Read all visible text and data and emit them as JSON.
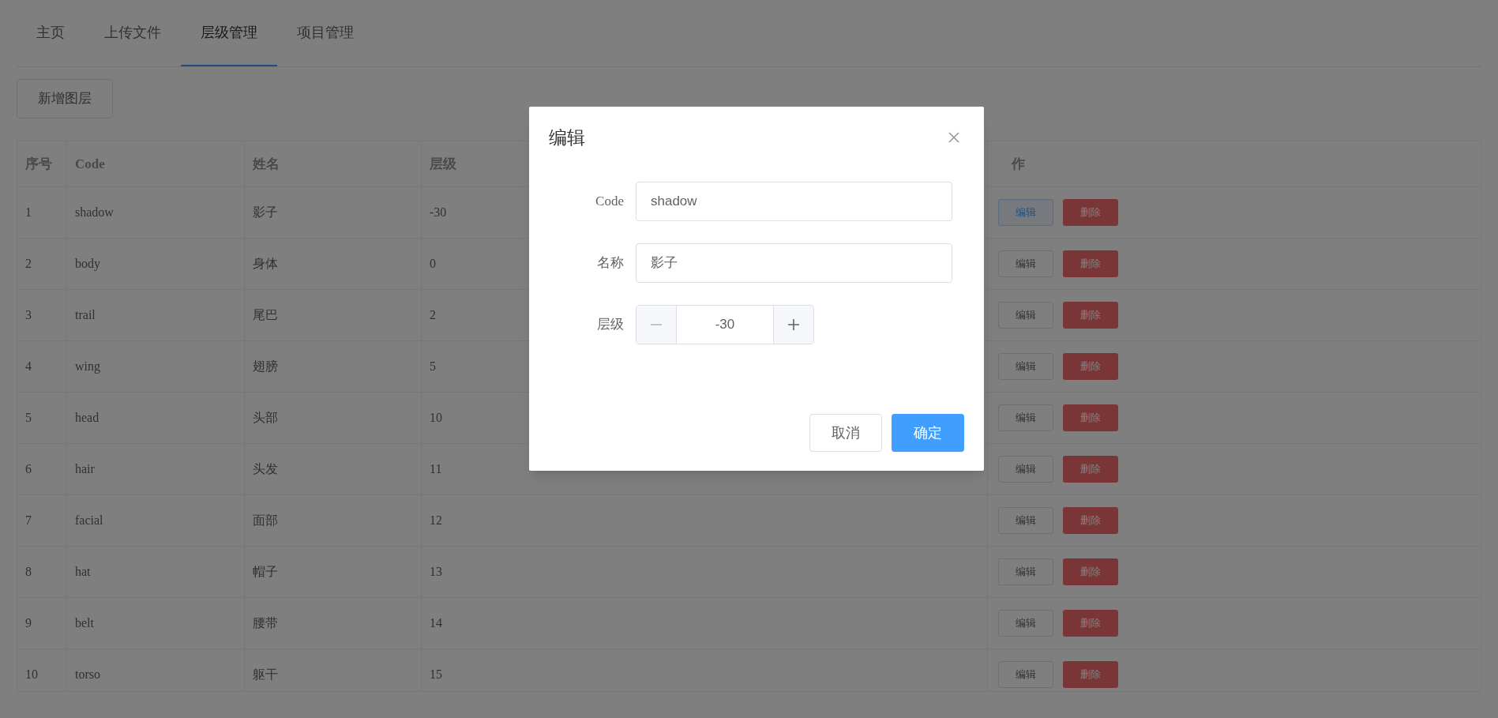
{
  "tabs": [
    {
      "label": "主页",
      "selected": false
    },
    {
      "label": "上传文件",
      "selected": false
    },
    {
      "label": "层级管理",
      "selected": true
    },
    {
      "label": "项目管理",
      "selected": false
    }
  ],
  "add_button": "新增图层",
  "table": {
    "columns": [
      "序号",
      "Code",
      "姓名",
      "层级",
      "作"
    ],
    "rows": [
      {
        "cells": [
          "1",
          "shadow",
          "影子",
          "-30"
        ],
        "edit": "编辑",
        "edit_focused": true,
        "delete": "删除"
      },
      {
        "cells": [
          "2",
          "body",
          "身体",
          "0"
        ],
        "edit": "编辑",
        "edit_focused": false,
        "delete": "删除"
      },
      {
        "cells": [
          "3",
          "trail",
          "尾巴",
          "2"
        ],
        "edit": "编辑",
        "edit_focused": false,
        "delete": "删除"
      },
      {
        "cells": [
          "4",
          "wing",
          "翅膀",
          "5"
        ],
        "edit": "编辑",
        "edit_focused": false,
        "delete": "删除"
      },
      {
        "cells": [
          "5",
          "head",
          "头部",
          "10"
        ],
        "edit": "编辑",
        "edit_focused": false,
        "delete": "删除"
      },
      {
        "cells": [
          "6",
          "hair",
          "头发",
          "11"
        ],
        "edit": "编辑",
        "edit_focused": false,
        "delete": "删除"
      },
      {
        "cells": [
          "7",
          "facial",
          "面部",
          "12"
        ],
        "edit": "编辑",
        "edit_focused": false,
        "delete": "删除"
      },
      {
        "cells": [
          "8",
          "hat",
          "帽子",
          "13"
        ],
        "edit": "编辑",
        "edit_focused": false,
        "delete": "删除"
      },
      {
        "cells": [
          "9",
          "belt",
          "腰带",
          "14"
        ],
        "edit": "编辑",
        "edit_focused": false,
        "delete": "删除"
      },
      {
        "cells": [
          "10",
          "torso",
          "躯干",
          "15"
        ],
        "edit": "编辑",
        "edit_focused": false,
        "delete": "删除"
      }
    ]
  },
  "dialog": {
    "title": "编辑",
    "fields": [
      {
        "kind": "text",
        "label": "Code",
        "value": "shadow"
      },
      {
        "kind": "text",
        "label": "名称",
        "value": "影子"
      },
      {
        "kind": "number",
        "label": "层级",
        "value": "-30",
        "minus_disabled": true
      }
    ],
    "buttons": [
      {
        "label": "取消",
        "primary": false
      },
      {
        "label": "确定",
        "primary": true
      }
    ]
  }
}
